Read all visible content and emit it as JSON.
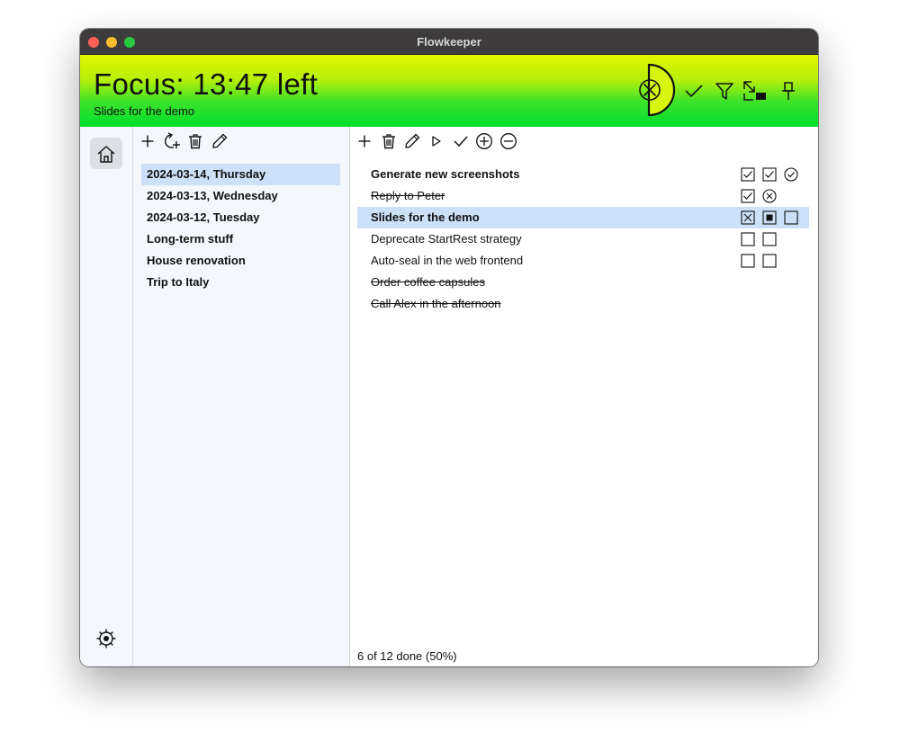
{
  "window": {
    "title": "Flowkeeper"
  },
  "focus": {
    "title": "Focus: 13:47 left",
    "subtitle": "Slides for the demo"
  },
  "header_buttons": [
    "check-icon",
    "filter-icon",
    "swap-icon",
    "pin-icon"
  ],
  "backlog_toolbar": [
    "plus-icon",
    "refresh-add-icon",
    "trash-icon",
    "pencil-icon"
  ],
  "task_toolbar": [
    "plus-icon",
    "trash-icon",
    "pencil-icon",
    "play-icon",
    "check-icon",
    "circle-plus-icon",
    "circle-minus-icon"
  ],
  "backlogs": [
    {
      "label": "2024-03-14, Thursday",
      "selected": true
    },
    {
      "label": "2024-03-13, Wednesday",
      "selected": false
    },
    {
      "label": "2024-03-12, Tuesday",
      "selected": false
    },
    {
      "label": "Long-term stuff",
      "selected": false
    },
    {
      "label": "House renovation",
      "selected": false
    },
    {
      "label": "Trip to Italy",
      "selected": false
    }
  ],
  "tasks": [
    {
      "name": "Generate new screenshots",
      "bold": true,
      "done": false,
      "selected": false,
      "pomodoros": [
        "checked",
        "checked",
        "circle-check"
      ]
    },
    {
      "name": "Reply to Peter",
      "bold": false,
      "done": true,
      "selected": false,
      "pomodoros": [
        "checked",
        "circle-x"
      ]
    },
    {
      "name": "Slides for the demo",
      "bold": true,
      "done": false,
      "selected": true,
      "pomodoros": [
        "x-box",
        "running",
        "empty"
      ]
    },
    {
      "name": "Deprecate StartRest strategy",
      "bold": false,
      "done": false,
      "selected": false,
      "pomodoros": [
        "empty",
        "empty"
      ]
    },
    {
      "name": "Auto-seal in the web frontend",
      "bold": false,
      "done": false,
      "selected": false,
      "pomodoros": [
        "empty",
        "empty"
      ]
    },
    {
      "name": "Order coffee capsules",
      "bold": false,
      "done": true,
      "selected": false,
      "pomodoros": []
    },
    {
      "name": "Call Alex in the afternoon",
      "bold": false,
      "done": true,
      "selected": false,
      "pomodoros": []
    }
  ],
  "status": "6 of 12 done (50%)",
  "colors": {
    "selection": "#cce0f8",
    "header_top": "#e5f500",
    "header_bottom": "#00df2e",
    "timer_fill": "#d6f50f"
  }
}
